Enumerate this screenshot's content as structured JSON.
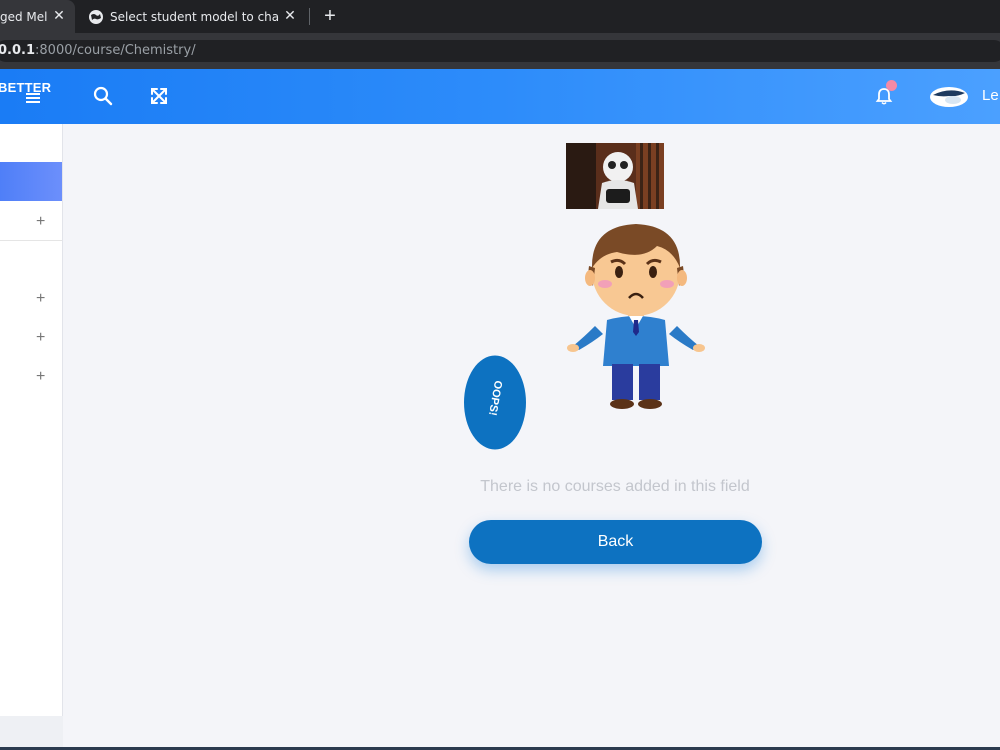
{
  "browser": {
    "tabs": [
      {
        "label": "ged Melat",
        "active": true
      },
      {
        "label": "Select student model to change |",
        "active": false
      }
    ],
    "close_glyph": "✕",
    "new_tab_glyph": "+",
    "url": {
      "host": "0.0.1",
      "rest": ":8000/course/Chemistry/"
    }
  },
  "header": {
    "brand": "BETTER",
    "icons": [
      "menu-icon",
      "search-icon",
      "fullscreen-icon",
      "bell-icon"
    ],
    "user_name": "Le"
  },
  "sidebar": {
    "expand_glyph": "+"
  },
  "main": {
    "oops_label": "OOPS!",
    "message": "There is no courses added in this field",
    "back_label": "Back"
  },
  "colors": {
    "header_start": "#1a7cf5",
    "header_end": "#4ba0ff",
    "button": "#0d72c1",
    "sidebar_active": "#5b86f9",
    "notification_dot": "#f58aa5"
  }
}
